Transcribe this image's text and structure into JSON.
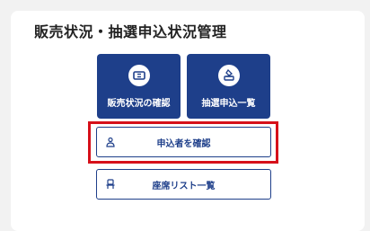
{
  "section": {
    "title": "販売状況・抽選申込状況管理"
  },
  "tiles": [
    {
      "label": "販売状況の確認",
      "icon": "ticket-icon"
    },
    {
      "label": "抽選申込一覧",
      "icon": "ballot-box-icon"
    }
  ],
  "buttons": [
    {
      "label": "申込者を確認",
      "icon": "person-icon"
    },
    {
      "label": "座席リスト一覧",
      "icon": "seat-icon"
    }
  ],
  "colors": {
    "brand": "#1e3f8a",
    "highlight": "#d6101a",
    "background": "#f2f2f2"
  }
}
